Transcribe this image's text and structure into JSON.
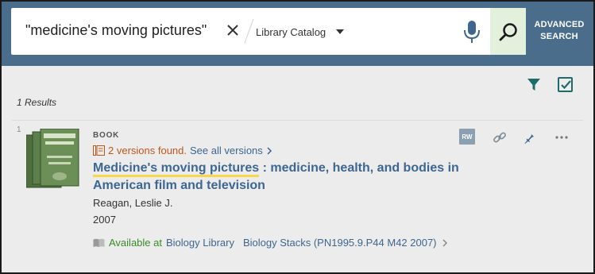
{
  "search": {
    "query": "\"medicine's moving pictures\"",
    "scope": "Library Catalog",
    "advanced_line1": "ADVANCED",
    "advanced_line2": "SEARCH"
  },
  "results": {
    "count_label": "1 Results"
  },
  "record": {
    "number": "1",
    "type": "BOOK",
    "versions_text": "2 versions found.",
    "versions_link": "See all versions",
    "title_highlight": "Medicine's moving pictures",
    "title_rest": " : medicine, health, and bodies in American film and television",
    "author": "Reagan, Leslie J.",
    "year": "2007",
    "availability_label": "Available at",
    "location": "Biology Library",
    "call_number": "Biology Stacks (PN1995.9.P44 M42 2007)",
    "rw_badge": "RW"
  },
  "colors": {
    "header_bg": "#4a6d8c",
    "accent_link": "#3d6690",
    "available_green": "#3a8a2a",
    "versions_orange": "#c0571a",
    "highlight_yellow": "#f7d84b",
    "toolbar_teal": "#1f6b6b"
  },
  "icons": [
    "close-icon",
    "chevron-down-icon",
    "microphone-icon",
    "search-icon",
    "filter-icon",
    "select-check-icon",
    "versions-icon",
    "chevron-right-icon",
    "link-icon",
    "pin-icon",
    "more-icon",
    "book-icon"
  ]
}
